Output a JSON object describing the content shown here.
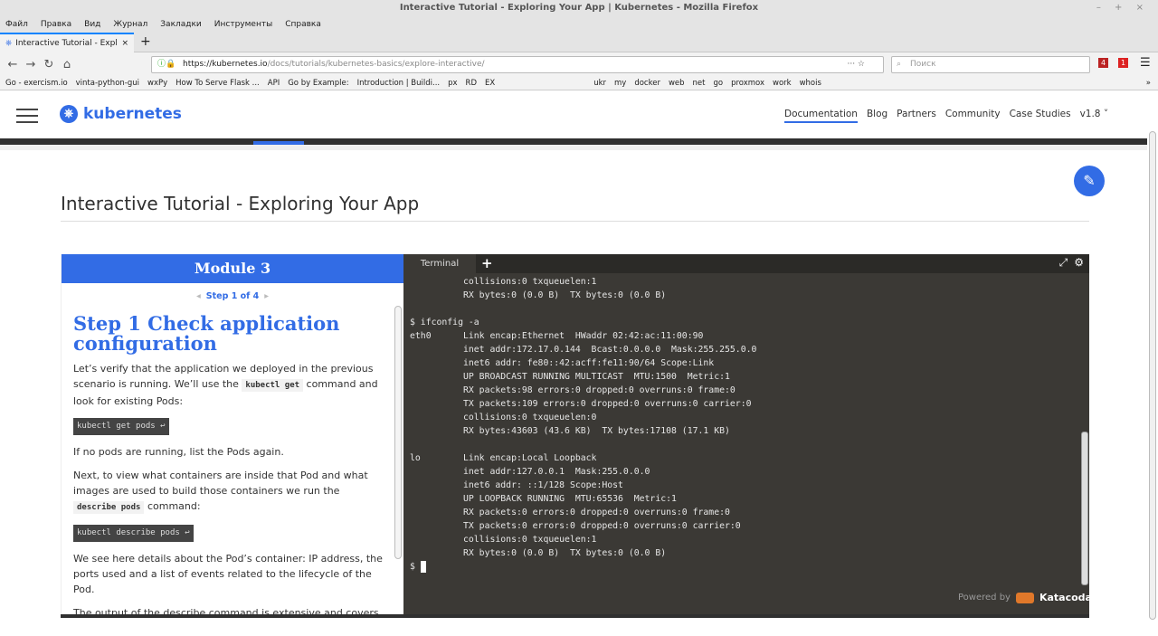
{
  "window": {
    "title": "Interactive Tutorial - Exploring Your App | Kubernetes - Mozilla Firefox",
    "controls": "– + ×"
  },
  "menu": [
    "Файл",
    "Правка",
    "Вид",
    "Журнал",
    "Закладки",
    "Инструменты",
    "Справка"
  ],
  "tab": {
    "label": "Interactive Tutorial - Explorin",
    "close": "×",
    "new": "+"
  },
  "nav": {
    "back": "←",
    "forward": "→",
    "reload": "↻",
    "home": "⌂",
    "url_host": "https://kubernetes.io",
    "url_path": "/docs/tutorials/kubernetes-basics/explore-interactive/",
    "page_actions": "··· ☆",
    "search_placeholder": "Поиск",
    "badge1": "4",
    "badge2": "1",
    "menu": "☰"
  },
  "bookmarks": [
    "Go - exercism.io",
    "vinta-python-gui",
    "wxPy",
    "How To Serve Flask ...",
    "API",
    "Go by Example:",
    "Introduction | Buildi...",
    "px",
    "RD",
    "EX",
    "ukr",
    "my",
    "docker",
    "web",
    "net",
    "go",
    "proxmox",
    "work",
    "whois",
    "»"
  ],
  "site": {
    "logo": "kubernetes",
    "nav": [
      "Documentation",
      "Blog",
      "Partners",
      "Community",
      "Case Studies",
      "v1.8 ˅"
    ],
    "page_title": "Interactive Tutorial - Exploring Your App",
    "edit_icon": "✎"
  },
  "left": {
    "module": "Module 3",
    "step_nav": "Step 1 of 4",
    "prev": "◂",
    "next": "▸",
    "step_title": "Step 1 Check application configuration",
    "p1a": "Let’s verify that the application we deployed in the previous scenario is running. We’ll use the ",
    "p1code": "kubectl get",
    "p1b": " command and look for existing Pods:",
    "cmd1": "kubectl get pods ↩",
    "p2": "If no pods are running, list the Pods again.",
    "p3a": "Next, to view what containers are inside that Pod and what images are used to build those containers we run the ",
    "p3code": "describe pods",
    "p3b": " command:",
    "cmd2": "kubectl describe pods ↩",
    "p4": "We see here details about the Pod’s container: IP address, the ports used and a list of events related to the lifecycle of the Pod.",
    "p5": "The output of the describe command is extensive and covers some concepts that we didn’t explain yet, but don’t worry, they will become familiar by the end of this bootcamp."
  },
  "terminal": {
    "tab": "Terminal",
    "add": "+",
    "fullscreen": "⤢",
    "settings": "⚙",
    "output": "          collisions:0 txqueuelen:1\n          RX bytes:0 (0.0 B)  TX bytes:0 (0.0 B)\n\n$ ifconfig -a\neth0      Link encap:Ethernet  HWaddr 02:42:ac:11:00:90\n          inet addr:172.17.0.144  Bcast:0.0.0.0  Mask:255.255.0.0\n          inet6 addr: fe80::42:acff:fe11:90/64 Scope:Link\n          UP BROADCAST RUNNING MULTICAST  MTU:1500  Metric:1\n          RX packets:98 errors:0 dropped:0 overruns:0 frame:0\n          TX packets:109 errors:0 dropped:0 overruns:0 carrier:0\n          collisions:0 txqueuelen:0\n          RX bytes:43603 (43.6 KB)  TX bytes:17108 (17.1 KB)\n\nlo        Link encap:Local Loopback\n          inet addr:127.0.0.1  Mask:255.0.0.0\n          inet6 addr: ::1/128 Scope:Host\n          UP LOOPBACK RUNNING  MTU:65536  Metric:1\n          RX packets:0 errors:0 dropped:0 overruns:0 frame:0\n          TX packets:0 errors:0 dropped:0 overruns:0 carrier:0\n          collisions:0 txqueuelen:1\n          RX bytes:0 (0.0 B)  TX bytes:0 (0.0 B)\n",
    "prompt": "$ ",
    "powered_by": "Powered by",
    "brand": "Katacoda"
  }
}
